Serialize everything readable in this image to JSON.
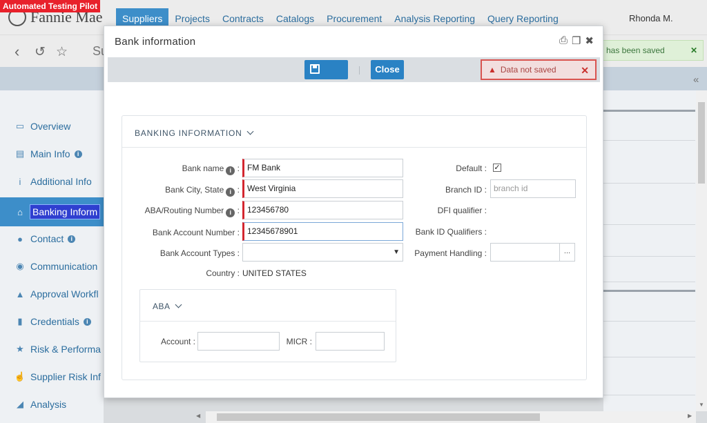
{
  "test_badge": "Automated Testing Pilot",
  "brand": "Fannie Mae",
  "nav": [
    "Suppliers",
    "Projects",
    "Contracts",
    "Catalogs",
    "Procurement",
    "Analysis Reporting",
    "Query Reporting"
  ],
  "user": "Rhonda M.",
  "subbar_title": "Su",
  "toast_saved": "has been saved",
  "toast_error": "Data not saved",
  "sidebar": [
    {
      "label": "Overview",
      "icon": "monitor-icon",
      "glyph": "▭",
      "info": false
    },
    {
      "label": "Main Info",
      "icon": "id-card-icon",
      "glyph": "▤",
      "info": true
    },
    {
      "label": "Additional Info",
      "icon": "info-icon",
      "glyph": "i",
      "info": false
    },
    {
      "label": "Banking Inform",
      "icon": "bank-icon",
      "glyph": "⌂",
      "info": false,
      "active": true
    },
    {
      "label": "Contact",
      "icon": "users-icon",
      "glyph": "●",
      "info": true
    },
    {
      "label": "Communication",
      "icon": "comments-icon",
      "glyph": "◉",
      "info": false
    },
    {
      "label": "Approval Workfl",
      "icon": "road-icon",
      "glyph": "▲",
      "info": false
    },
    {
      "label": "Credentials",
      "icon": "book-icon",
      "glyph": "▮",
      "info": true
    },
    {
      "label": "Risk & Performa",
      "icon": "star-icon",
      "glyph": "★",
      "info": false
    },
    {
      "label": "Supplier Risk Inf",
      "icon": "thumbs-up-icon",
      "glyph": "☝",
      "info": false
    },
    {
      "label": "Analysis",
      "icon": "chart-icon",
      "glyph": "◢",
      "info": false
    }
  ],
  "modal": {
    "title": "Bank information",
    "save_label": "Save",
    "close_label": "Close",
    "section_title": "BANKING INFORMATION",
    "fields": {
      "bank_name_label": "Bank name",
      "bank_name_value": "FM Bank",
      "bank_city_label": "Bank City, State",
      "bank_city_value": "West Virginia",
      "aba_label": "ABA/Routing Number",
      "aba_value": "123456780",
      "account_number_label": "Bank Account Number :",
      "account_number_value": "12345678901",
      "account_types_label": "Bank Account Types :",
      "account_types_value": "",
      "country_label": "Country :",
      "country_value": "UNITED STATES",
      "default_label": "Default :",
      "default_checked": true,
      "branch_id_label": "Branch ID :",
      "branch_id_placeholder": "branch id",
      "dfi_label": "DFI qualifier :",
      "bank_id_label": "Bank ID Qualifiers :",
      "payment_label": "Payment Handling :",
      "payment_value": "",
      "colon": ":"
    },
    "aba_section": {
      "title": "ABA",
      "account_label": "Account :",
      "account_value": "",
      "micr_label": "MICR :",
      "micr_value": ""
    }
  },
  "colors": {
    "accent": "#3d8ec9",
    "button": "#2a82c4",
    "required": "#d3262f",
    "error": "#d9534f",
    "success_bg": "#dff0d8"
  }
}
